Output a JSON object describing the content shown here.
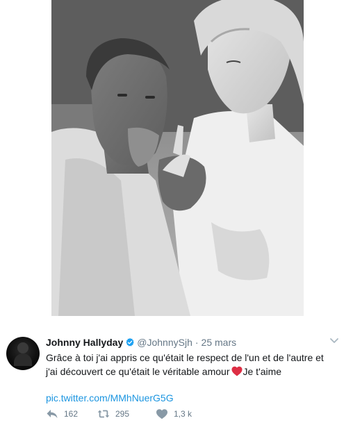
{
  "tweet": {
    "author_name": "Johnny Hallyday",
    "handle": "@JohnnySjh",
    "separator": "·",
    "date": "25 mars",
    "text_line1": "Grâce à toi j'ai appris ce qu'était le respect de l'un et de l'autre et",
    "text_line2_before_heart": "j'ai découvert ce qu'était le véritable amour",
    "text_line2_after_heart": "Je t'aime",
    "link": "pic.twitter.com/MMhNuerG5G",
    "heart_emoji": "red-heart-icon"
  },
  "stats": {
    "replies": "162",
    "retweets": "295",
    "likes": "1,3 k"
  },
  "colors": {
    "link": "#1b95e0",
    "secondary_text": "#657786",
    "verified": "#1da1f2",
    "heart": "#e0245e"
  },
  "icons": [
    "verified-badge-icon",
    "chevron-down-icon",
    "reply-icon",
    "retweet-icon",
    "like-icon"
  ]
}
